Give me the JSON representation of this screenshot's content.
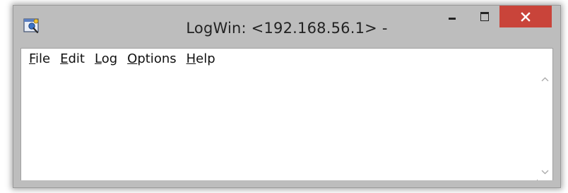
{
  "window": {
    "title": "LogWin: <192.168.56.1> -",
    "controls": {
      "minimize": "minimize-icon",
      "maximize": "maximize-icon",
      "close": "close-icon"
    },
    "close_color": "#c9443a"
  },
  "menubar": {
    "items": [
      {
        "name": "file",
        "mnemonic": "F",
        "rest": "ile"
      },
      {
        "name": "edit",
        "mnemonic": "E",
        "rest": "dit"
      },
      {
        "name": "log",
        "mnemonic": "L",
        "rest": "og"
      },
      {
        "name": "options",
        "mnemonic": "O",
        "rest": "ptions"
      },
      {
        "name": "help",
        "mnemonic": "H",
        "rest": "elp"
      }
    ]
  },
  "log": {
    "lines": []
  }
}
